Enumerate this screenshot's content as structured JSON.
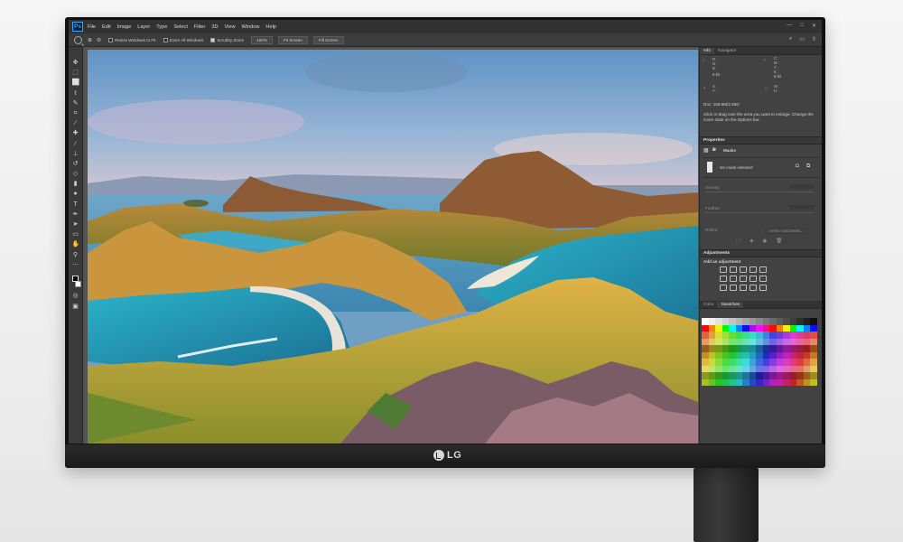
{
  "app": {
    "logo": "Ps",
    "menu": [
      "File",
      "Edit",
      "Image",
      "Layer",
      "Type",
      "Select",
      "Filter",
      "3D",
      "View",
      "Window",
      "Help"
    ]
  },
  "options_bar": {
    "checkboxes": [
      {
        "label": "Resize Windows to Fit",
        "checked": false
      },
      {
        "label": "Zoom All Windows",
        "checked": false
      },
      {
        "label": "Scrubby Zoom",
        "checked": true
      }
    ],
    "buttons": [
      "100%",
      "Fit Screen",
      "Fill Screen"
    ]
  },
  "info_panel": {
    "tabs": [
      "Info",
      "Navigator"
    ],
    "rgb_labels": [
      "R :",
      "G :",
      "B :"
    ],
    "bit_label": "8-bit",
    "cmyk_labels": [
      "C :",
      "M :",
      "Y :",
      "K :"
    ],
    "xy_labels": [
      "X :",
      "Y :"
    ],
    "wh_labels": [
      "W :",
      "H :"
    ],
    "doc": "Doc: 168.9M/2.86G",
    "hint": "Click or drag over the area you want to enlarge. Change the zoom state on the Options bar."
  },
  "properties_panel": {
    "title": "Properties",
    "masks_label": "Masks",
    "mask_status": "No mask selected",
    "density_label": "Density:",
    "feather_label": "Feather:",
    "refine_label": "Refine:",
    "select_mask_label": "Select and Mask..."
  },
  "adjustments_panel": {
    "title": "Adjustments",
    "subtitle": "Add an adjustment"
  },
  "swatches_panel": {
    "tabs": [
      "Color",
      "Swatches"
    ]
  },
  "monitor": {
    "brand": "LG"
  },
  "colors": {
    "ps_blue": "#31a8ff",
    "ps_dark": "#001e36"
  }
}
